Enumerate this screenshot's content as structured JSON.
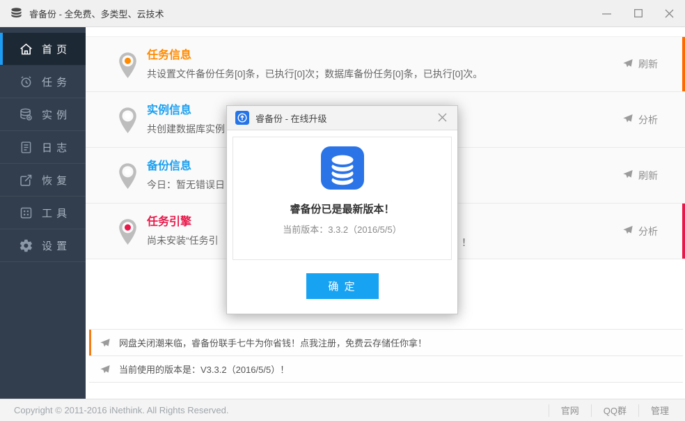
{
  "window": {
    "title": "睿备份 - 全免费、多类型、云技术",
    "controls": {
      "minimize": "minimize",
      "maximize": "maximize",
      "close": "close"
    }
  },
  "colors": {
    "sidebar_bg": "#323e4e",
    "sidebar_active_bg": "#1d2835",
    "accent_blue": "#1e9df5",
    "title_orange": "#ff8a00",
    "title_blue": "#1ba0f0",
    "title_red": "#e8184a",
    "bar_orange": "#ff6a00",
    "notice_orange": "#f57a12",
    "button_blue": "#18a3f2",
    "dialog_icon_blue": "#2b74e8"
  },
  "sidebar": {
    "items": [
      {
        "label": "首 页",
        "icon": "home-icon",
        "active": true
      },
      {
        "label": "任 务",
        "icon": "alarm-icon",
        "active": false
      },
      {
        "label": "实 例",
        "icon": "database-icon",
        "active": false
      },
      {
        "label": "日 志",
        "icon": "log-icon",
        "active": false
      },
      {
        "label": "恢 复",
        "icon": "restore-icon",
        "active": false
      },
      {
        "label": "工 具",
        "icon": "tools-icon",
        "active": false
      },
      {
        "label": "设 置",
        "icon": "settings-icon",
        "active": false
      }
    ]
  },
  "dashboard": {
    "rows": [
      {
        "title": "任务信息",
        "subtitle": "共设置文件备份任务[0]条，已执行[0]次；数据库备份任务[0]条，已执行[0]次。",
        "action": "刷新"
      },
      {
        "title": "实例信息",
        "subtitle": "共创建数据库实例",
        "action": "分析"
      },
      {
        "title": "备份信息",
        "subtitle": "今日：暂无错误日",
        "action": "刷新"
      },
      {
        "title": "任务引擎",
        "subtitle": "尚未安装“任务引",
        "subtitle_tail": "！",
        "action": "分析"
      }
    ]
  },
  "notices": [
    {
      "text": "网盘关闭潮来临，睿备份联手七牛为你省钱！点我注册，免费云存储任你拿！"
    },
    {
      "text": "当前使用的版本是：V3.3.2（2016/5/5）！"
    }
  ],
  "dialog": {
    "title": "睿备份 - 在线升级",
    "message": "睿备份已是最新版本！",
    "version_line": "当前版本：3.3.2（2016/5/5）",
    "ok_label": "确 定"
  },
  "footer": {
    "copyright": "Copyright © 2011-2016 iNethink. All Rights Reserved.",
    "links": [
      "官网",
      "QQ群",
      "管理"
    ]
  }
}
